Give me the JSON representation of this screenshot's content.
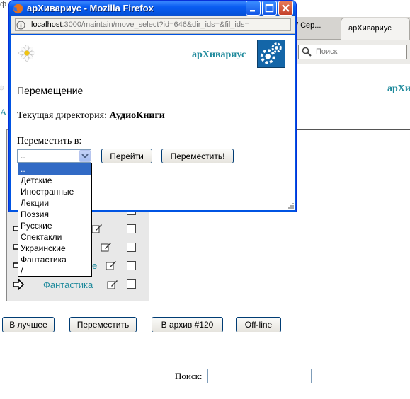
{
  "popup": {
    "title": "арХивариус - Mozilla Firefox",
    "url_host": "localhost",
    "url_rest": ":3000/maintain/move_select?id=646&dir_ids=&fil_ids=",
    "logo_text": "арХивариус",
    "heading": "Перемещение",
    "current_dir_label": "Текущая директория:",
    "current_dir_value": "АудиоКниги",
    "move_to_label": "Переместить в:",
    "select_value": "..",
    "go_button": "Перейти",
    "move_button": "Переместить!",
    "options": [
      "..",
      "Детские",
      "Иностранные",
      "Лекции",
      "Поэзия",
      "Русские",
      "Спектакли",
      "Украинские",
      "Фантастика",
      "/"
    ]
  },
  "background": {
    "tab_prev_label": "/ Сер...",
    "tab_active_label": "арХивариус",
    "search_placeholder": "Поиск",
    "logo_text": "арХи",
    "letter_a": "А",
    "top_clip": "ф",
    "list_rows": [
      {
        "label": ""
      },
      {
        "label": ""
      },
      {
        "label": ""
      },
      {
        "label": "е"
      },
      {
        "label": "Фантастика"
      }
    ],
    "action_buttons": {
      "best": "В лучшее",
      "move": "Переместить",
      "archive": "В архив #120",
      "offline": "Off-line"
    },
    "search_label": "Поиск:"
  }
}
